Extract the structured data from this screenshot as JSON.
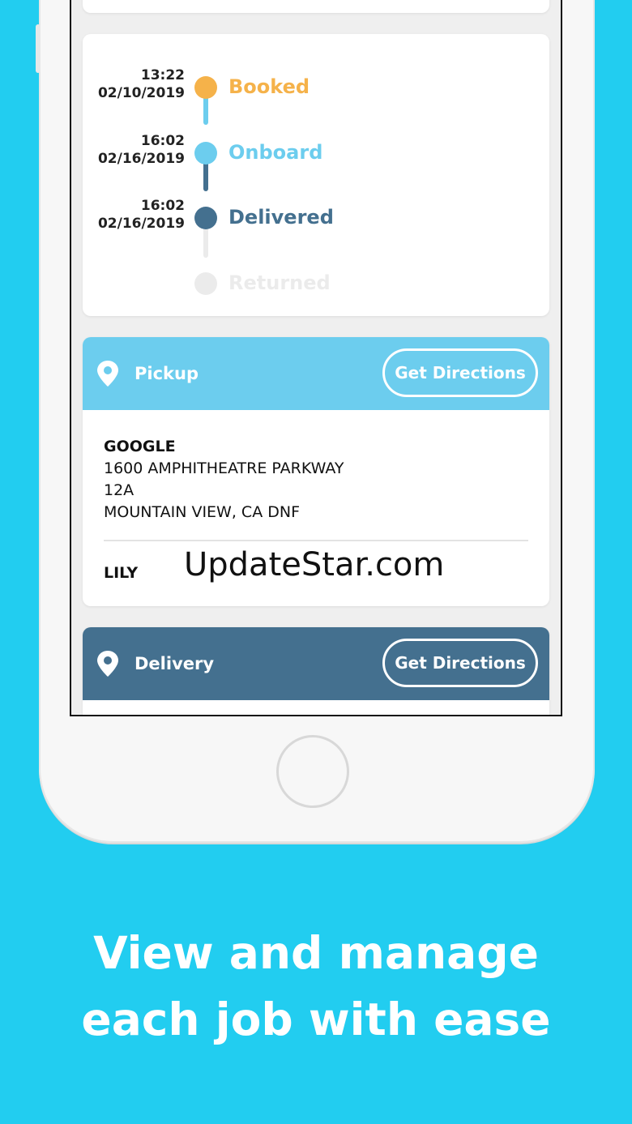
{
  "timeline": [
    {
      "time": "13:22",
      "date": "02/10/2019",
      "label": "Booked",
      "color": "#f5b24a"
    },
    {
      "time": "16:02",
      "date": "02/16/2019",
      "label": "Onboard",
      "color": "#6ccdee"
    },
    {
      "time": "16:02",
      "date": "02/16/2019",
      "label": "Delivered",
      "color": "#44708f"
    },
    {
      "time": "",
      "date": "",
      "label": "Returned",
      "color": "#ebebeb"
    }
  ],
  "pickup": {
    "title": "Pickup",
    "directions_label": "Get Directions",
    "header_color": "#6ccdee",
    "name": "GOOGLE",
    "line1": "1600 AMPHITHEATRE PARKWAY",
    "line2": "12A",
    "line3": "MOUNTAIN VIEW, CA DNF",
    "contact": "LILY"
  },
  "delivery": {
    "title": "Delivery",
    "directions_label": "Get Directions",
    "header_color": "#44708f"
  },
  "watermark": "UpdateStar.com",
  "caption": {
    "line1": "View and manage",
    "line2": "each job with ease"
  },
  "colors": {
    "background": "#22cdf0",
    "connector_booked_onboard": "#6ccdee",
    "connector_onboard_delivered": "#44708f",
    "connector_delivered_returned": "#ebebeb"
  },
  "icons": [
    "location-pin-icon"
  ]
}
